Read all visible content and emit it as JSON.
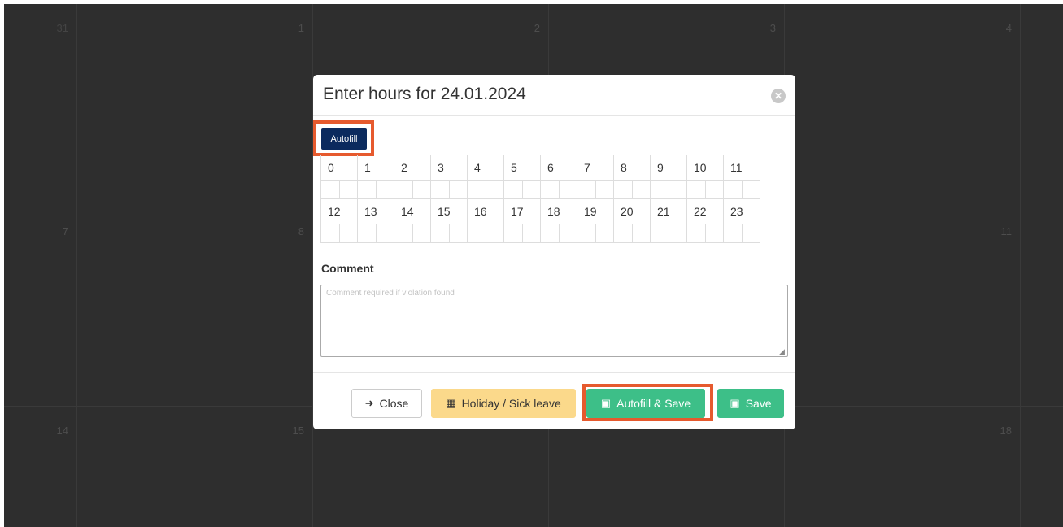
{
  "calendar": {
    "rows": [
      [
        "31",
        "1",
        "2",
        "3",
        "4"
      ],
      [
        "7",
        "8",
        "",
        "",
        "11"
      ],
      [
        "14",
        "15",
        "",
        "",
        "18"
      ]
    ]
  },
  "modal": {
    "title": "Enter hours for 24.01.2024",
    "close_icon": "✕",
    "autofill_label": "Autofill",
    "hours_row1": [
      "0",
      "1",
      "2",
      "3",
      "4",
      "5",
      "6",
      "7",
      "8",
      "9",
      "10",
      "11"
    ],
    "hours_row2": [
      "12",
      "13",
      "14",
      "15",
      "16",
      "17",
      "18",
      "19",
      "20",
      "21",
      "22",
      "23"
    ],
    "comment_label": "Comment",
    "comment_placeholder": "Comment required if violation found",
    "comment_value": "",
    "buttons": {
      "close": {
        "label": "Close",
        "icon": "sign-out-icon"
      },
      "holiday": {
        "label": "Holiday / Sick leave",
        "icon": "calendar-icon"
      },
      "autofill_save": {
        "label": "Autofill & Save",
        "icon": "floppy-disk-icon"
      },
      "save": {
        "label": "Save",
        "icon": "floppy-disk-icon"
      }
    }
  },
  "colors": {
    "highlight": "#e65a2e",
    "autofill_button": "#0b2a5e",
    "save_green": "#3dbf88",
    "holiday_yellow": "#fbd98b",
    "backdrop": "#2e2e2e"
  }
}
